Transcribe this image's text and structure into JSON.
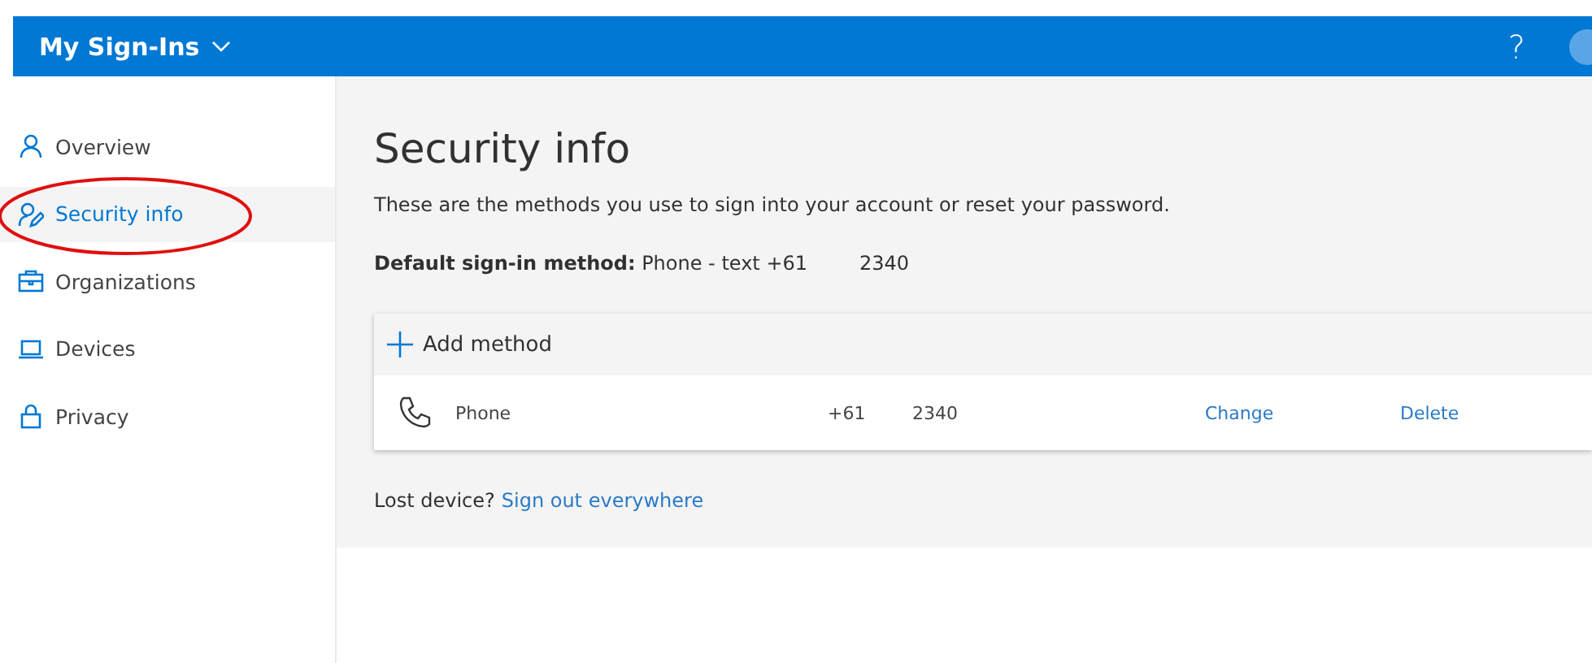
{
  "header": {
    "title": "My Sign-Ins",
    "help": "?"
  },
  "sidebar": {
    "items": [
      {
        "label": "Overview",
        "kind": "person",
        "selected": false
      },
      {
        "label": "Security info",
        "kind": "editor",
        "selected": true
      },
      {
        "label": "Organizations",
        "kind": "briefcase",
        "selected": false
      },
      {
        "label": "Devices",
        "kind": "laptop",
        "selected": false
      },
      {
        "label": "Privacy",
        "kind": "lock",
        "selected": false
      }
    ]
  },
  "page": {
    "title": "Security info",
    "description": "These are the methods you use to sign into your account or reset your password.",
    "default_method": {
      "label": "**Default sign-in method:** Phone - text +61",
      "number_end": "2340"
    },
    "add_method": "Add method",
    "methods": [
      {
        "name": "Phone",
        "prefix": "+61",
        "number_end": "2340",
        "change": "Change",
        "delete": "Delete"
      }
    ],
    "lost_device": {
      "text": "Lost device?",
      "link": "Sign out everywhere"
    }
  },
  "annotation": {
    "kind": "ellipse"
  }
}
